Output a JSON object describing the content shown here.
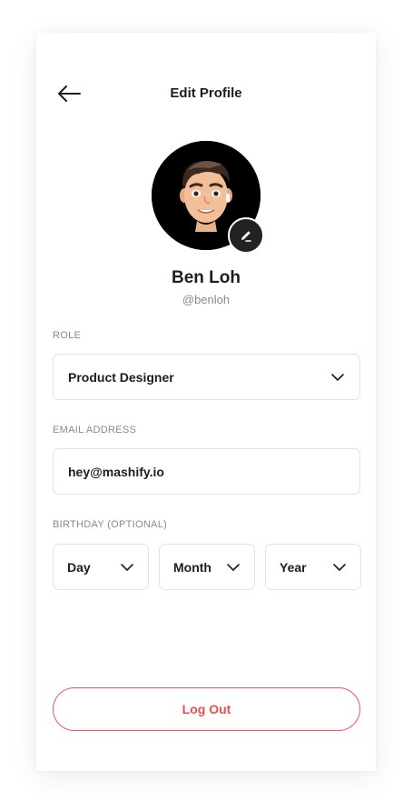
{
  "header": {
    "title": "Edit Profile",
    "back_icon": "arrow-left-icon"
  },
  "profile": {
    "name": "Ben Loh",
    "handle": "@benloh",
    "avatar": "memoji-avatar",
    "edit_icon": "pencil-icon"
  },
  "role": {
    "label": "ROLE",
    "value": "Product Designer"
  },
  "email": {
    "label": "EMAIL ADDRESS",
    "value": "hey@mashify.io"
  },
  "birthday": {
    "label": "BIRTHDAY (OPTIONAL)",
    "day": "Day",
    "month": "Month",
    "year": "Year"
  },
  "logout": {
    "label": "Log Out",
    "color": "#e8504e"
  }
}
